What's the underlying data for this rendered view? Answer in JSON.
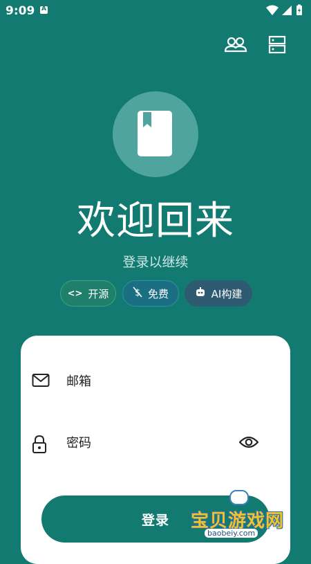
{
  "status_bar": {
    "time": "9:09",
    "icons": [
      "app-notification-icon",
      "wifi-icon",
      "signal-icon",
      "battery-charging-icon"
    ]
  },
  "header": {
    "icons": [
      "group-icon",
      "server-icon"
    ]
  },
  "hero": {
    "logo_icon": "bookmark-book-icon",
    "title": "欢迎回来",
    "subtitle": "登录以继续"
  },
  "chips": [
    {
      "icon": "code-icon",
      "label": "开源"
    },
    {
      "icon": "dollar-slash-icon",
      "label": "免费"
    },
    {
      "icon": "robot-icon",
      "label": "AI构建"
    }
  ],
  "form": {
    "email_placeholder": "邮箱",
    "password_placeholder": "密码",
    "login_label": "登录"
  },
  "watermark": {
    "text": "宝贝游戏网",
    "url": "baobeiy.com"
  },
  "colors": {
    "background": "#137a72",
    "card": "#ffffff",
    "chip_open": "#1f7f6a",
    "chip_free": "#1b6f82",
    "chip_ai": "#2e5a72",
    "button": "#137a72"
  }
}
